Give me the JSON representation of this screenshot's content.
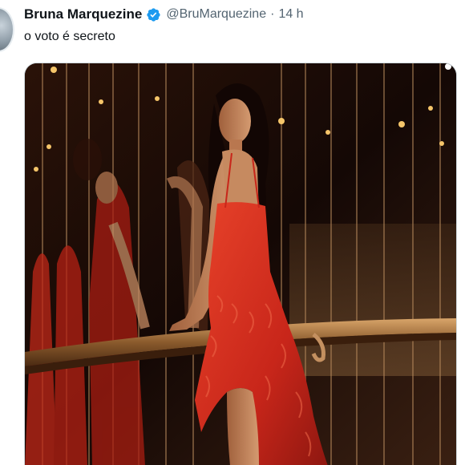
{
  "tweet": {
    "display_name": "Bruna Marquezine",
    "handle": "@BruMarquezine",
    "separator": "·",
    "timestamp": "14 h",
    "text": "o voto é secreto",
    "verified": true
  },
  "icons": {
    "verified": "verified-badge-icon"
  },
  "colors": {
    "text_primary": "#0f1419",
    "text_secondary": "#536471",
    "verified_blue": "#1d9bf0",
    "dress_red": "#d8301f"
  }
}
